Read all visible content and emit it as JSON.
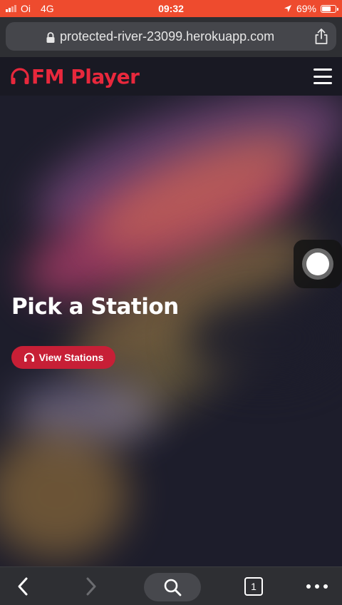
{
  "status_bar": {
    "carrier": "Oi",
    "network": "4G",
    "time": "09:32",
    "battery": "69%",
    "battery_level": 0.69
  },
  "browser": {
    "url": "protected-river-23099.herokuapp.com",
    "tab_count": "1"
  },
  "app": {
    "brand": "FM Player",
    "brand_color": "#e8283c"
  },
  "hero": {
    "title": "Pick a Station",
    "cta_label": "View Stations",
    "cta_color": "#c71f36"
  },
  "icons": {
    "brand": "headphones-icon",
    "menu": "hamburger-menu-icon",
    "cta": "headphones-icon",
    "lock": "lock-icon",
    "share": "share-icon",
    "back": "chevron-left-icon",
    "forward": "chevron-right-icon",
    "search": "search-icon",
    "tabs": "tabs-icon",
    "more": "more-dots-icon"
  }
}
